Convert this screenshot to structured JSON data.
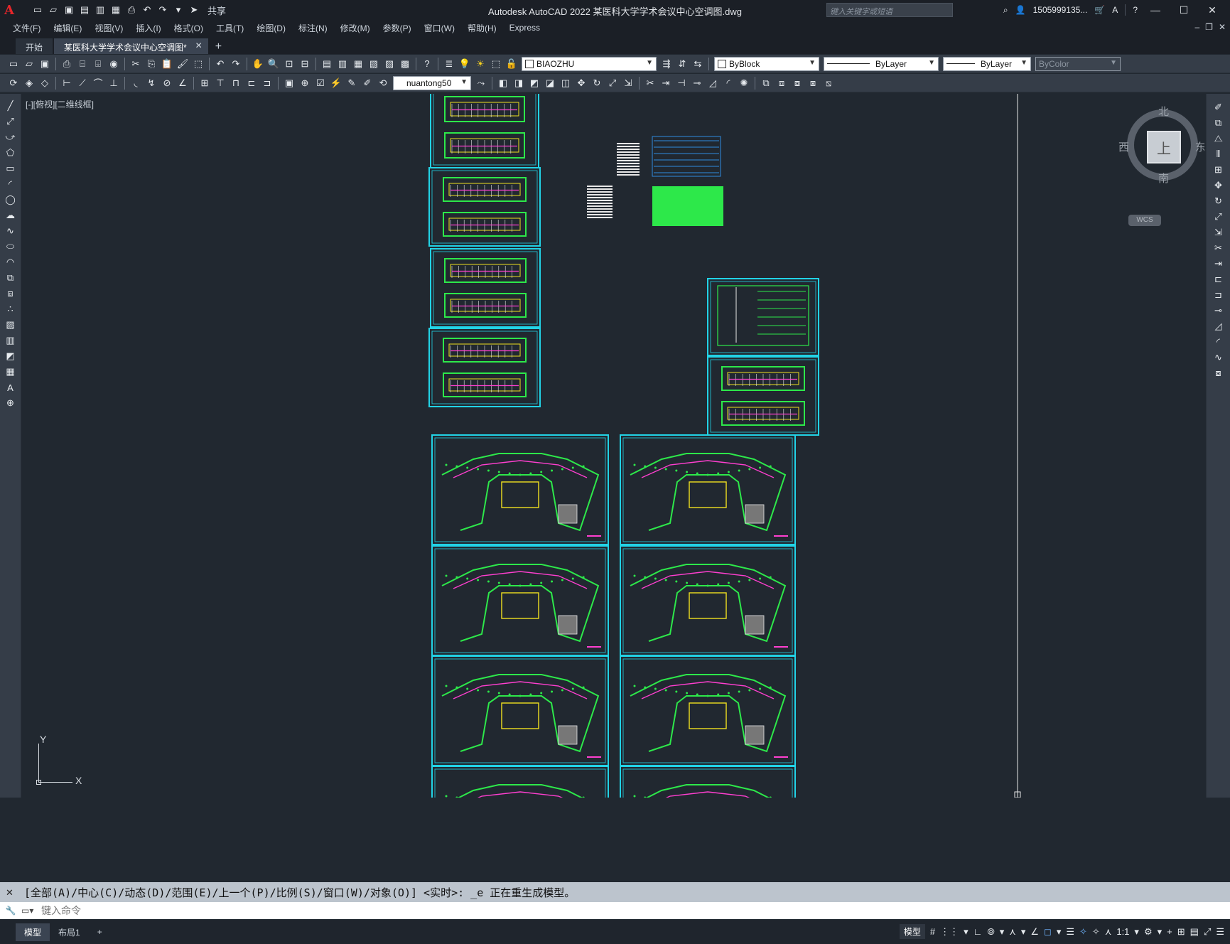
{
  "window": {
    "title": "Autodesk AutoCAD 2022    某医科大学学术会议中心空调图.dwg",
    "search_placeholder": "键入关键字或短语",
    "user": "1505999135...",
    "share_label": "共享"
  },
  "menu": [
    "文件(F)",
    "编辑(E)",
    "视图(V)",
    "插入(I)",
    "格式(O)",
    "工具(T)",
    "绘图(D)",
    "标注(N)",
    "修改(M)",
    "参数(P)",
    "窗口(W)",
    "帮助(H)",
    "Express"
  ],
  "tabs": [
    {
      "label": "开始",
      "active": false
    },
    {
      "label": "某医科大学学术会议中心空调图*",
      "active": true
    }
  ],
  "properties": {
    "layer": "BIAOZHU",
    "color": "ByBlock",
    "linetype": "ByLayer",
    "lineweight": "ByLayer",
    "plotstyle": "ByColor",
    "dimstyle": "nuantong50"
  },
  "viewport": {
    "label": "[-][俯视][二维线框]",
    "viewcube": {
      "north": "北",
      "south": "南",
      "east": "东",
      "west": "西",
      "top": "上",
      "wcs": "WCS"
    },
    "ucs": {
      "x": "X",
      "y": "Y"
    }
  },
  "command": {
    "history": "[全部(A)/中心(C)/动态(D)/范围(E)/上一个(P)/比例(S)/窗口(W)/对象(O)] <实时>: _e 正在重生成模型。",
    "placeholder": "键入命令"
  },
  "status": {
    "layout_tabs": [
      {
        "label": "模型",
        "active": true
      },
      {
        "label": "布局1",
        "active": false
      }
    ],
    "model_label": "模型",
    "scale": "1:1"
  },
  "colors": {
    "background": "#212830",
    "frame": "#22d3e6",
    "drawing_green": "#2de84a",
    "drawing_yellow": "#f0e020",
    "drawing_magenta": "#ff3fd0",
    "drawing_white": "#e8e8e8"
  }
}
